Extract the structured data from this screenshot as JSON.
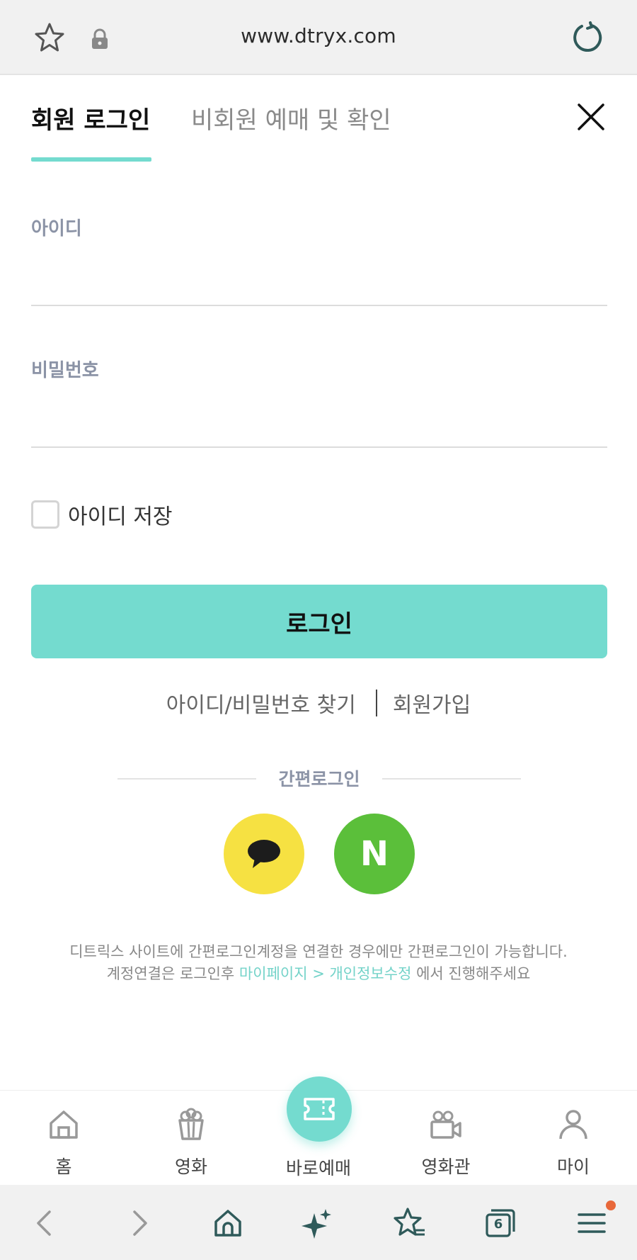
{
  "browser": {
    "url": "www.dtryx.com",
    "tabs_count": "6"
  },
  "tabs": {
    "member": "회원 로그인",
    "guest": "비회원 예매 및 확인"
  },
  "form": {
    "id_label": "아이디",
    "id_value": "",
    "pw_label": "비밀번호",
    "pw_value": "",
    "save_id_label": "아이디 저장",
    "save_id_checked": false,
    "login_button": "로그인"
  },
  "links": {
    "find": "아이디/비밀번호 찾기",
    "signup": "회원가입"
  },
  "easy_login": {
    "title": "간편로그인",
    "providers": [
      {
        "name": "kakao",
        "icon": "kakao-speech-bubble-icon",
        "color": "#f6e142"
      },
      {
        "name": "naver",
        "icon": "naver-n-icon",
        "letter": "N",
        "color": "#5bbf3a"
      }
    ]
  },
  "notice": {
    "line1": "디트릭스 사이트에 간편로그인계정을 연결한 경우에만 간편로그인이 가능합니다.",
    "line2_prefix": "계정연결은 로그인후 ",
    "line2_link": "마이페이지 > 개인정보수정",
    "line2_suffix": " 에서 진행해주세요"
  },
  "bottom_nav": [
    {
      "label": "홈",
      "icon": "home-icon"
    },
    {
      "label": "영화",
      "icon": "popcorn-icon"
    },
    {
      "label": "바로예매",
      "icon": "ticket-icon"
    },
    {
      "label": "영화관",
      "icon": "video-camera-icon"
    },
    {
      "label": "마이",
      "icon": "person-icon"
    }
  ],
  "colors": {
    "accent": "#74dbcf",
    "label_gray": "#8b93a6",
    "kakao": "#f6e142",
    "naver": "#5bbf3a",
    "notification": "#e8683a"
  }
}
